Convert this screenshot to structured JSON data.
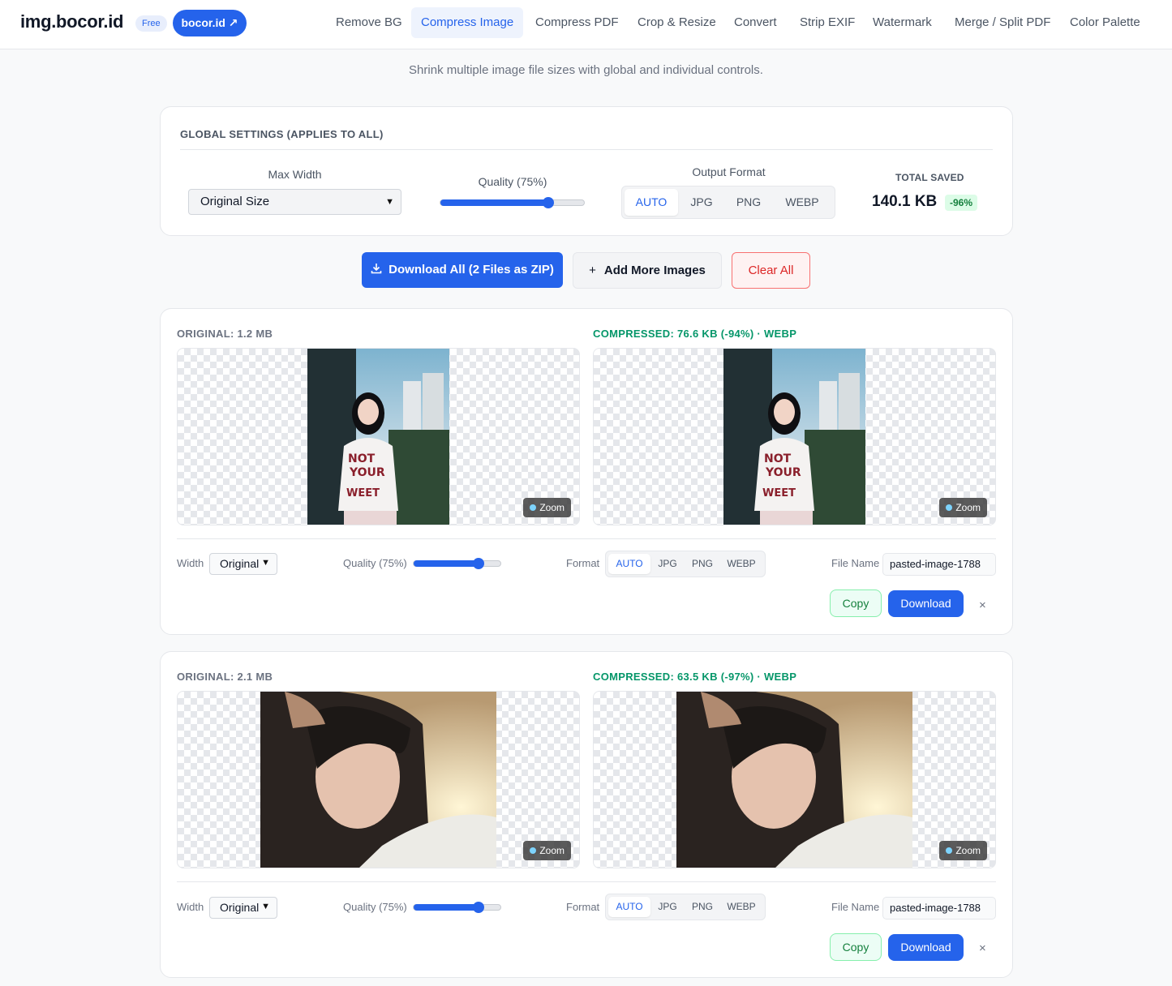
{
  "header": {
    "logo": "img.bocor.id",
    "badge": "Free",
    "brand_button": "bocor.id ↗",
    "nav": [
      "Remove BG",
      "Compress Image",
      "Compress PDF",
      "Crop & Resize",
      "Convert",
      "Strip EXIF",
      "Watermark",
      "Merge / Split PDF",
      "Color Palette"
    ],
    "active_nav": "Compress Image"
  },
  "subtitle": "Shrink multiple image file sizes with global and individual controls.",
  "global": {
    "title": "GLOBAL SETTINGS (APPLIES TO ALL)",
    "max_width_label": "Max Width",
    "max_width_value": "Original Size",
    "quality_label": "Quality (75%)",
    "quality": 0.75,
    "format_label": "Output Format",
    "formats": [
      "AUTO",
      "JPG",
      "PNG",
      "WEBP"
    ],
    "selected_format": "AUTO",
    "total_saved_label": "TOTAL SAVED",
    "total_saved_value": "140.1 KB",
    "total_saved_pct": "-96%"
  },
  "actions": {
    "download_all": "Download All (2 Files as ZIP)",
    "add_more": "Add More Images",
    "clear_all": "Clear All"
  },
  "images": [
    {
      "original": "ORIGINAL: 1.2 MB",
      "compressed": "COMPRESSED: 76.6 KB (-94%) · WEBP",
      "zoom": "Zoom",
      "width_label": "Width",
      "width_value": "Original",
      "quality_label": "Quality (75%)",
      "quality": 0.75,
      "format_label": "Format",
      "formats": [
        "AUTO",
        "JPG",
        "PNG",
        "WEBP"
      ],
      "file_name_label": "File Name",
      "file_name": "pasted-image-1788",
      "copy": "Copy",
      "download": "Download",
      "remove": "×"
    },
    {
      "original": "ORIGINAL: 2.1 MB",
      "compressed": "COMPRESSED: 63.5 KB (-97%) · WEBP",
      "zoom": "Zoom",
      "width_label": "Width",
      "width_value": "Original",
      "quality_label": "Quality (75%)",
      "quality": 0.75,
      "format_label": "Format",
      "formats": [
        "AUTO",
        "JPG",
        "PNG",
        "WEBP"
      ],
      "file_name_label": "File Name",
      "file_name": "pasted-image-1788",
      "copy": "Copy",
      "download": "Download",
      "remove": "×"
    }
  ],
  "colors": {
    "accent": "#2563eb",
    "success": "#059669",
    "danger": "#dc2626"
  }
}
